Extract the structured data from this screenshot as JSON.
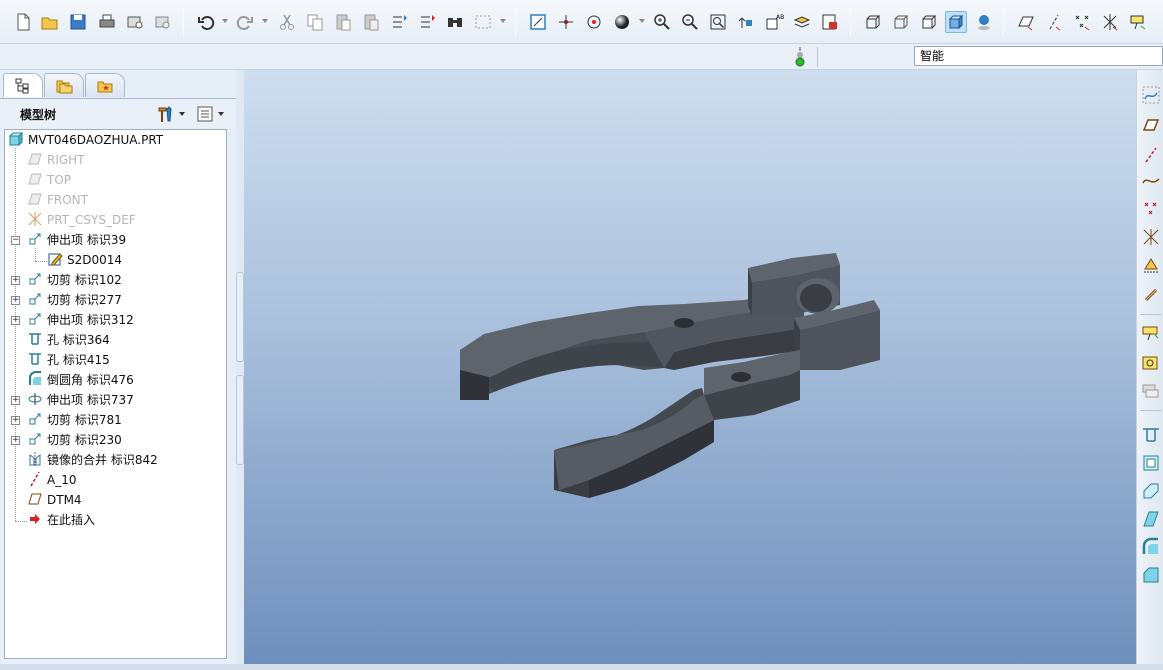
{
  "filter": {
    "value": "智能"
  },
  "panel": {
    "title": "模型树"
  },
  "tree": {
    "root": "MVT046DAOZHUA.PRT",
    "items": [
      {
        "label": "RIGHT",
        "dim": true
      },
      {
        "label": "TOP",
        "dim": true
      },
      {
        "label": "FRONT",
        "dim": true
      },
      {
        "label": "PRT_CSYS_DEF",
        "dim": true
      },
      {
        "label": "伸出项 标识39"
      },
      {
        "label": "S2D0014"
      },
      {
        "label": "切剪 标识102"
      },
      {
        "label": "切剪 标识277"
      },
      {
        "label": "伸出项 标识312"
      },
      {
        "label": "孔 标识364"
      },
      {
        "label": "孔 标识415"
      },
      {
        "label": "倒圆角 标识476"
      },
      {
        "label": "伸出项 标识737"
      },
      {
        "label": "切剪 标识781"
      },
      {
        "label": "切剪 标识230"
      },
      {
        "label": "镜像的合并 标识842"
      },
      {
        "label": "A_10"
      },
      {
        "label": "DTM4"
      },
      {
        "label": "在此插入"
      }
    ]
  },
  "colors": {
    "accent": "#2f7fc1",
    "model": "#555a63",
    "highlight_tab": "#bfe0f6"
  }
}
